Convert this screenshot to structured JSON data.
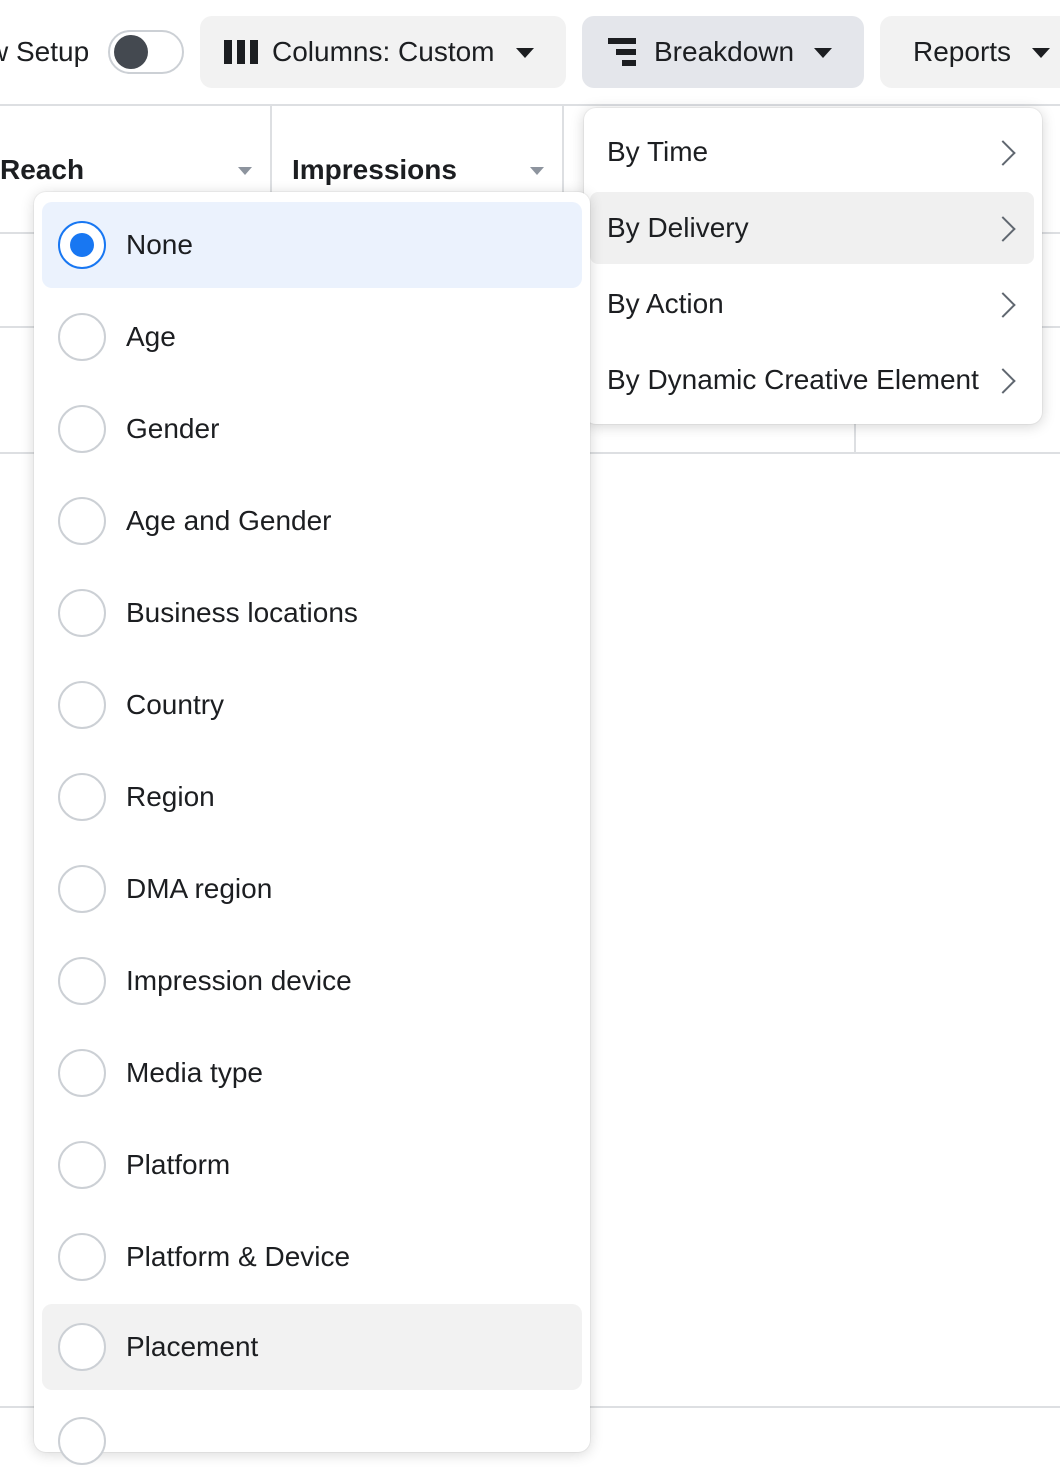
{
  "toolbar": {
    "setup_label": "w Setup",
    "setup_toggle_on": false,
    "columns_label": "Columns: Custom",
    "breakdown_label": "Breakdown",
    "reports_label": "Reports"
  },
  "table": {
    "columns": [
      {
        "label": "Reach"
      },
      {
        "label": "Impressions"
      }
    ]
  },
  "breakdown_menu": {
    "items": [
      {
        "label": "By Time"
      },
      {
        "label": "By Delivery"
      },
      {
        "label": "By Action"
      },
      {
        "label": "By Dynamic Creative Element"
      }
    ],
    "hovered": "By Delivery"
  },
  "delivery_menu": {
    "selected": "None",
    "hovered": "Placement",
    "options": [
      {
        "label": "None"
      },
      {
        "label": "Age"
      },
      {
        "label": "Gender"
      },
      {
        "label": "Age and Gender"
      },
      {
        "label": "Business locations"
      },
      {
        "label": "Country"
      },
      {
        "label": "Region"
      },
      {
        "label": "DMA region"
      },
      {
        "label": "Impression device"
      },
      {
        "label": "Media type"
      },
      {
        "label": "Platform"
      },
      {
        "label": "Platform & Device"
      },
      {
        "label": "Placement"
      },
      {
        "label": ""
      }
    ]
  },
  "colors": {
    "accent": "#1877f2",
    "selected_bg": "#ebf2fd",
    "hover_bg": "#f2f2f2"
  }
}
